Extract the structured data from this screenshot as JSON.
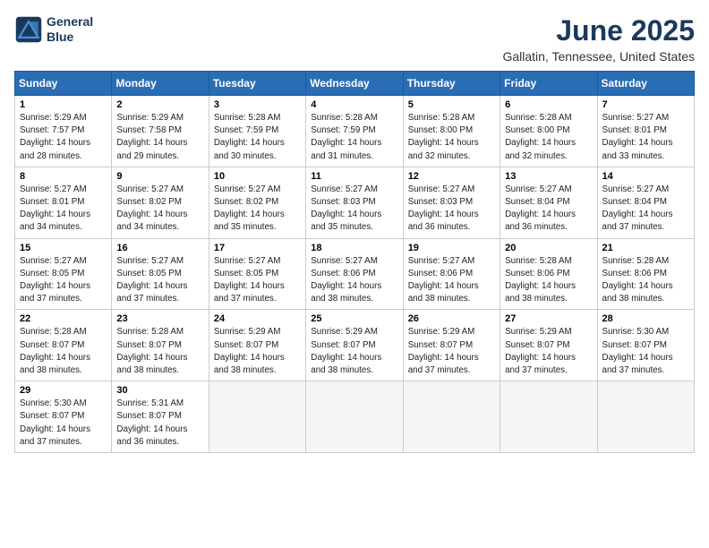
{
  "header": {
    "logo_line1": "General",
    "logo_line2": "Blue",
    "month": "June 2025",
    "location": "Gallatin, Tennessee, United States"
  },
  "days_of_week": [
    "Sunday",
    "Monday",
    "Tuesday",
    "Wednesday",
    "Thursday",
    "Friday",
    "Saturday"
  ],
  "weeks": [
    [
      {
        "day": "1",
        "info": "Sunrise: 5:29 AM\nSunset: 7:57 PM\nDaylight: 14 hours\nand 28 minutes."
      },
      {
        "day": "2",
        "info": "Sunrise: 5:29 AM\nSunset: 7:58 PM\nDaylight: 14 hours\nand 29 minutes."
      },
      {
        "day": "3",
        "info": "Sunrise: 5:28 AM\nSunset: 7:59 PM\nDaylight: 14 hours\nand 30 minutes."
      },
      {
        "day": "4",
        "info": "Sunrise: 5:28 AM\nSunset: 7:59 PM\nDaylight: 14 hours\nand 31 minutes."
      },
      {
        "day": "5",
        "info": "Sunrise: 5:28 AM\nSunset: 8:00 PM\nDaylight: 14 hours\nand 32 minutes."
      },
      {
        "day": "6",
        "info": "Sunrise: 5:28 AM\nSunset: 8:00 PM\nDaylight: 14 hours\nand 32 minutes."
      },
      {
        "day": "7",
        "info": "Sunrise: 5:27 AM\nSunset: 8:01 PM\nDaylight: 14 hours\nand 33 minutes."
      }
    ],
    [
      {
        "day": "8",
        "info": "Sunrise: 5:27 AM\nSunset: 8:01 PM\nDaylight: 14 hours\nand 34 minutes."
      },
      {
        "day": "9",
        "info": "Sunrise: 5:27 AM\nSunset: 8:02 PM\nDaylight: 14 hours\nand 34 minutes."
      },
      {
        "day": "10",
        "info": "Sunrise: 5:27 AM\nSunset: 8:02 PM\nDaylight: 14 hours\nand 35 minutes."
      },
      {
        "day": "11",
        "info": "Sunrise: 5:27 AM\nSunset: 8:03 PM\nDaylight: 14 hours\nand 35 minutes."
      },
      {
        "day": "12",
        "info": "Sunrise: 5:27 AM\nSunset: 8:03 PM\nDaylight: 14 hours\nand 36 minutes."
      },
      {
        "day": "13",
        "info": "Sunrise: 5:27 AM\nSunset: 8:04 PM\nDaylight: 14 hours\nand 36 minutes."
      },
      {
        "day": "14",
        "info": "Sunrise: 5:27 AM\nSunset: 8:04 PM\nDaylight: 14 hours\nand 37 minutes."
      }
    ],
    [
      {
        "day": "15",
        "info": "Sunrise: 5:27 AM\nSunset: 8:05 PM\nDaylight: 14 hours\nand 37 minutes."
      },
      {
        "day": "16",
        "info": "Sunrise: 5:27 AM\nSunset: 8:05 PM\nDaylight: 14 hours\nand 37 minutes."
      },
      {
        "day": "17",
        "info": "Sunrise: 5:27 AM\nSunset: 8:05 PM\nDaylight: 14 hours\nand 37 minutes."
      },
      {
        "day": "18",
        "info": "Sunrise: 5:27 AM\nSunset: 8:06 PM\nDaylight: 14 hours\nand 38 minutes."
      },
      {
        "day": "19",
        "info": "Sunrise: 5:27 AM\nSunset: 8:06 PM\nDaylight: 14 hours\nand 38 minutes."
      },
      {
        "day": "20",
        "info": "Sunrise: 5:28 AM\nSunset: 8:06 PM\nDaylight: 14 hours\nand 38 minutes."
      },
      {
        "day": "21",
        "info": "Sunrise: 5:28 AM\nSunset: 8:06 PM\nDaylight: 14 hours\nand 38 minutes."
      }
    ],
    [
      {
        "day": "22",
        "info": "Sunrise: 5:28 AM\nSunset: 8:07 PM\nDaylight: 14 hours\nand 38 minutes."
      },
      {
        "day": "23",
        "info": "Sunrise: 5:28 AM\nSunset: 8:07 PM\nDaylight: 14 hours\nand 38 minutes."
      },
      {
        "day": "24",
        "info": "Sunrise: 5:29 AM\nSunset: 8:07 PM\nDaylight: 14 hours\nand 38 minutes."
      },
      {
        "day": "25",
        "info": "Sunrise: 5:29 AM\nSunset: 8:07 PM\nDaylight: 14 hours\nand 38 minutes."
      },
      {
        "day": "26",
        "info": "Sunrise: 5:29 AM\nSunset: 8:07 PM\nDaylight: 14 hours\nand 37 minutes."
      },
      {
        "day": "27",
        "info": "Sunrise: 5:29 AM\nSunset: 8:07 PM\nDaylight: 14 hours\nand 37 minutes."
      },
      {
        "day": "28",
        "info": "Sunrise: 5:30 AM\nSunset: 8:07 PM\nDaylight: 14 hours\nand 37 minutes."
      }
    ],
    [
      {
        "day": "29",
        "info": "Sunrise: 5:30 AM\nSunset: 8:07 PM\nDaylight: 14 hours\nand 37 minutes."
      },
      {
        "day": "30",
        "info": "Sunrise: 5:31 AM\nSunset: 8:07 PM\nDaylight: 14 hours\nand 36 minutes."
      },
      {
        "day": "",
        "info": ""
      },
      {
        "day": "",
        "info": ""
      },
      {
        "day": "",
        "info": ""
      },
      {
        "day": "",
        "info": ""
      },
      {
        "day": "",
        "info": ""
      }
    ]
  ]
}
